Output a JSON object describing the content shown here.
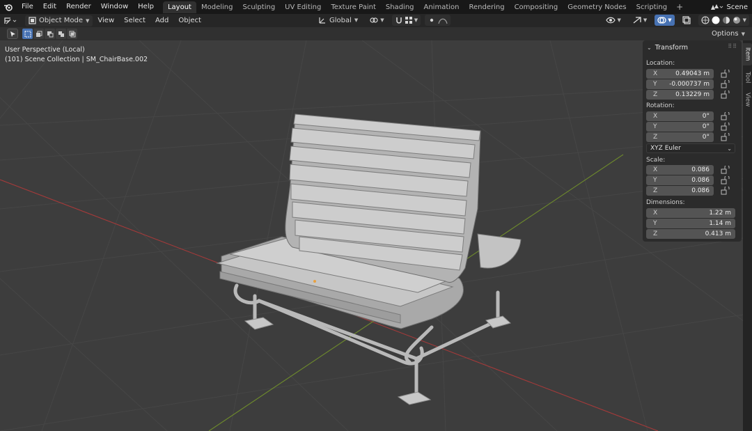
{
  "menu": {
    "logo_icon": "blender-logo-icon",
    "items": [
      "File",
      "Edit",
      "Render",
      "Window",
      "Help"
    ]
  },
  "workspaces": {
    "tabs": [
      "Layout",
      "Modeling",
      "Sculpting",
      "UV Editing",
      "Texture Paint",
      "Shading",
      "Animation",
      "Rendering",
      "Compositing",
      "Geometry Nodes",
      "Scripting"
    ],
    "active": "Layout",
    "add_label": "+"
  },
  "scene": {
    "label": "Scene"
  },
  "header": {
    "mode": "Object Mode",
    "menus": [
      "View",
      "Select",
      "Add",
      "Object"
    ],
    "orientation": "Global"
  },
  "tool_header": {
    "options_label": "Options"
  },
  "viewport": {
    "perspective": "User Perspective (Local)",
    "collection": "(101) Scene Collection | SM_ChairBase.002"
  },
  "npanel": {
    "title": "Transform",
    "location_label": "Location:",
    "location": [
      {
        "axis": "X",
        "value": "0.49043 m"
      },
      {
        "axis": "Y",
        "value": "-0.000737 m"
      },
      {
        "axis": "Z",
        "value": "0.13229 m"
      }
    ],
    "rotation_label": "Rotation:",
    "rotation": [
      {
        "axis": "X",
        "value": "0°"
      },
      {
        "axis": "Y",
        "value": "0°"
      },
      {
        "axis": "Z",
        "value": "0°"
      }
    ],
    "rotation_mode": "XYZ Euler",
    "scale_label": "Scale:",
    "scale": [
      {
        "axis": "X",
        "value": "0.086"
      },
      {
        "axis": "Y",
        "value": "0.086"
      },
      {
        "axis": "Z",
        "value": "0.086"
      }
    ],
    "dimensions_label": "Dimensions:",
    "dimensions": [
      {
        "axis": "X",
        "value": "1.22 m"
      },
      {
        "axis": "Y",
        "value": "1.14 m"
      },
      {
        "axis": "Z",
        "value": "0.413 m"
      }
    ]
  },
  "sidetabs": [
    "Item",
    "Tool",
    "View"
  ],
  "colors": {
    "accent": "#4772b3",
    "x_axis": "#a33a3a",
    "y_axis": "#6e8b2c",
    "viewport_bg": "#3d3d3d"
  }
}
